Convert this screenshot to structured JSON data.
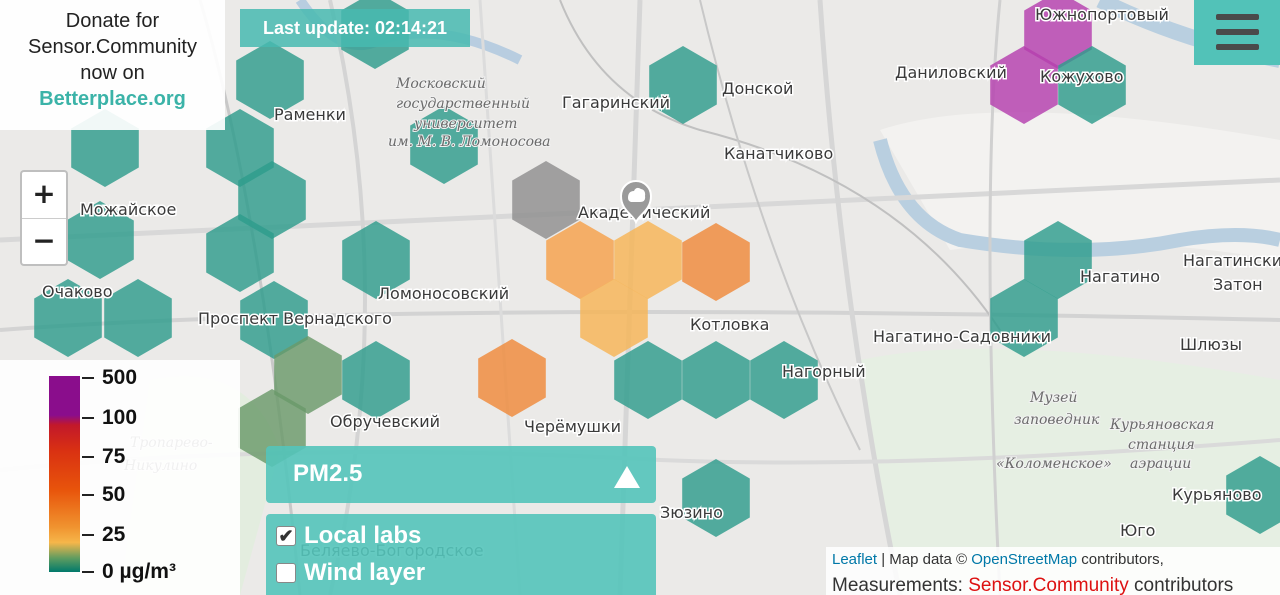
{
  "donate": {
    "line1": "Donate for",
    "line2": "Sensor.Community",
    "line3": "now on",
    "link": "Betterplace.org"
  },
  "last_update": "Last update: 02:14:21",
  "menu": {
    "icon": "hamburger-menu-icon"
  },
  "zoom": {
    "in": "+",
    "out": "−"
  },
  "legend": {
    "labels": [
      "500",
      "100",
      "75",
      "50",
      "25",
      "0 µg/m³"
    ],
    "colors": {
      "top": "#8a0d8c",
      "red": "#c2182a",
      "orange": "#e8540b",
      "yellow": "#f6b64a",
      "bottom": "#00796b"
    }
  },
  "pm_selector": {
    "label": "PM2.5",
    "icon": "triangle-up-icon"
  },
  "layers": [
    {
      "label": "Local labs",
      "checked": true
    },
    {
      "label": "Wind layer",
      "checked": false
    }
  ],
  "attribution": {
    "leaflet": "Leaflet",
    "sep": " | Map data © ",
    "osm": "OpenStreetMap",
    "contributors": " contributors,",
    "measurements": "Measurements: ",
    "sc": "Sensor.Community",
    "contributors2": " contributors"
  },
  "map_labels": [
    "Южнопортовый",
    "Даниловский",
    "Кожухово",
    "Донской",
    "Гагаринский",
    "Раменки",
    "Московский",
    "государственный",
    "университет",
    "им. М. В. Ломоносова",
    "Канатчиково",
    "Академический",
    "Ломоносовский",
    "Очаково",
    "Проспект Вернадского",
    "Котловка",
    "Нагатино",
    "Нагатинский",
    "Затон",
    "Нагатино-Садовники",
    "Нагорный",
    "Шлюзы",
    "Обручевский",
    "Черёмушки",
    "Тропарево-",
    "Никулино",
    "Музей",
    "заповедник",
    "«Коломенское»",
    "Курьяновская",
    "станция",
    "аэрации",
    "Курьяново",
    "Зюзино",
    "Беляево-Богородское",
    "Юго",
    "Можайское"
  ],
  "hex_colors": {
    "teal": "#2e9c8c",
    "grey": "#8f8f8f",
    "orange": "#f5a14a",
    "dark-orange": "#ef8a3a",
    "light-orange": "#f7b455",
    "purple": "#b43fae",
    "olive": "#6a9a6a"
  }
}
